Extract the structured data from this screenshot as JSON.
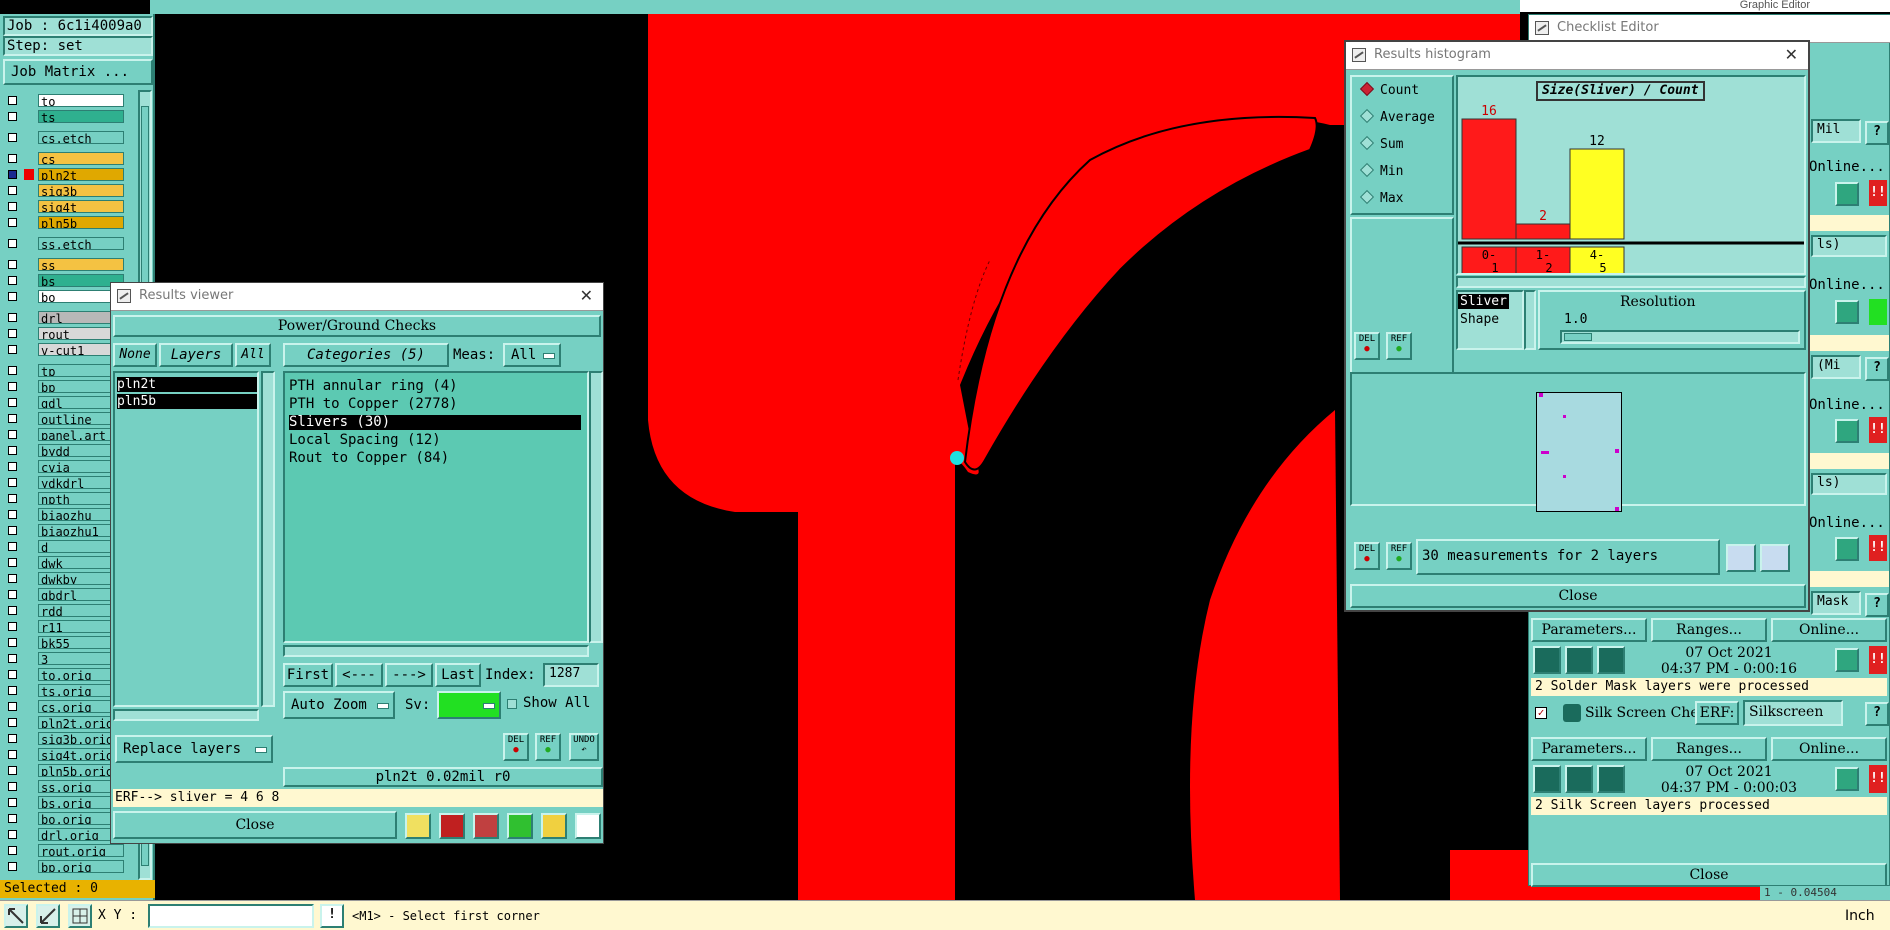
{
  "job": {
    "job_label": "Job : 6c1i4009a0",
    "step_label": "Step: set",
    "matrix_button": "Job Matrix ..."
  },
  "layers": [
    {
      "name": "to",
      "color": "#ffffff"
    },
    {
      "name": "ts",
      "color": "#2fb08f"
    },
    {
      "name": "cs.etch",
      "color": "#76d0c3"
    },
    {
      "name": "cs",
      "color": "#f4c242"
    },
    {
      "name": "pln2t",
      "color": "#e0a800"
    },
    {
      "name": "sig3b",
      "color": "#f4c242"
    },
    {
      "name": "sig4t",
      "color": "#f4c242"
    },
    {
      "name": "pln5b",
      "color": "#e0a800"
    },
    {
      "name": "ss.etch",
      "color": "#76d0c3"
    },
    {
      "name": "ss",
      "color": "#f4c242"
    },
    {
      "name": "bs",
      "color": "#2fb08f"
    },
    {
      "name": "bo",
      "color": "#ffffff"
    },
    {
      "name": "drl",
      "color": "#b8b8b8"
    },
    {
      "name": "rout",
      "color": "#d8d8d8"
    },
    {
      "name": "v-cut1",
      "color": "#d8d8d8"
    },
    {
      "name": "tp",
      "color": "#76d0c3"
    },
    {
      "name": "bp",
      "color": "#76d0c3"
    },
    {
      "name": "gdl",
      "color": "#76d0c3"
    },
    {
      "name": "outline",
      "color": "#76d0c3"
    },
    {
      "name": "panel.art",
      "color": "#76d0c3"
    },
    {
      "name": "bydd",
      "color": "#76d0c3"
    },
    {
      "name": "cvia",
      "color": "#76d0c3"
    },
    {
      "name": "ydkdrl",
      "color": "#76d0c3"
    },
    {
      "name": "npth",
      "color": "#76d0c3"
    },
    {
      "name": "biaozhu",
      "color": "#76d0c3"
    },
    {
      "name": "biaozhu1",
      "color": "#76d0c3"
    },
    {
      "name": "d",
      "color": "#76d0c3"
    },
    {
      "name": "dwk",
      "color": "#76d0c3"
    },
    {
      "name": "dwkby",
      "color": "#76d0c3"
    },
    {
      "name": "gbdrl",
      "color": "#76d0c3"
    },
    {
      "name": "rdd",
      "color": "#76d0c3"
    },
    {
      "name": "r11",
      "color": "#76d0c3"
    },
    {
      "name": "bk55",
      "color": "#76d0c3"
    },
    {
      "name": "3",
      "color": "#76d0c3"
    },
    {
      "name": "to.orig",
      "color": "#76d0c3"
    },
    {
      "name": "ts.orig",
      "color": "#76d0c3"
    },
    {
      "name": "cs.orig",
      "color": "#76d0c3"
    },
    {
      "name": "pln2t.orig",
      "color": "#76d0c3"
    },
    {
      "name": "sig3b.orig",
      "color": "#76d0c3"
    },
    {
      "name": "sig4t.orig",
      "color": "#76d0c3"
    },
    {
      "name": "pln5b.orig",
      "color": "#76d0c3"
    },
    {
      "name": "ss.orig",
      "color": "#76d0c3"
    },
    {
      "name": "bs.orig",
      "color": "#76d0c3"
    },
    {
      "name": "bo.orig",
      "color": "#76d0c3"
    },
    {
      "name": "drl.orig",
      "color": "#76d0c3"
    },
    {
      "name": "rout.orig",
      "color": "#76d0c3"
    },
    {
      "name": "bp.orig",
      "color": "#76d0c3"
    }
  ],
  "selected_label": "Selected : 0",
  "top_right_title": "Graphic Editor",
  "checklist": {
    "title": "Checklist Editor",
    "fragments": [
      "Mil",
      "ls)",
      "(Mi",
      "ls)",
      "Mask"
    ],
    "params_label": "Parameters...",
    "ranges_label": "Ranges...",
    "online_label": "Online...",
    "run1_date": "07 Oct 2021",
    "run1_time": "04:37 PM - 0:00:16",
    "run1_msg": "2 Solder Mask layers were processed",
    "silk_name": "Silk Screen Che",
    "erf_label": "ERF:",
    "erf_value": "Silkscreen",
    "run2_date": "07 Oct 2021",
    "run2_time": "04:37 PM - 0:00:03",
    "run2_msg": "2 Silk Screen layers processed",
    "close_label": "Close",
    "under_text": "1 - 0.04504"
  },
  "results_viewer": {
    "title": "Results viewer",
    "header": "Power/Ground Checks",
    "none_btn": "None",
    "layers_btn": "Layers",
    "all_btn": "All",
    "categories_btn": "Categories (5)",
    "meas_label": "Meas:",
    "meas_value": "All",
    "layers_list": [
      "pln2t",
      "pln5b"
    ],
    "categories": [
      "PTH annular ring (4)",
      "PTH to Copper (2778)",
      "Slivers (30)",
      "Local Spacing (12)",
      "Rout to Copper (84)"
    ],
    "first_btn": "First",
    "prev_btn": "<---",
    "next_btn": "--->",
    "last_btn": "Last",
    "index_label": "Index:",
    "index_value": "1287",
    "autozoom_btn": "Auto Zoom",
    "sv_label": "Sv:",
    "showall_label": "Show All",
    "replace_btn": "Replace layers",
    "del_label": "DEL",
    "ref_label": "REF",
    "undo_label": "UNDO",
    "status": "pln2t 0.02mil  r0",
    "erf_line": "ERF--> sliver = 4 6 8",
    "close_label": "Close"
  },
  "histogram": {
    "title": "Results histogram",
    "modes": [
      "Count",
      "Average",
      "Sum",
      "Min",
      "Max"
    ],
    "selected_mode": "Count",
    "chart_title": "Size(Sliver) / Count",
    "attr_items": [
      "Sliver",
      "Shape"
    ],
    "resolution_label": "Resolution",
    "resolution_value": "1.0",
    "del_label": "DEL",
    "ref_label": "REF",
    "summary": "30 measurements for 2 layers",
    "close_label": "Close",
    "colors": {
      "red": "#ff1a1a",
      "yellow": "#ffff22"
    }
  },
  "chart_data": {
    "type": "bar",
    "title": "Size(Sliver) / Count",
    "categories": [
      "0-1",
      "1-2",
      "4-5"
    ],
    "values": [
      16,
      2,
      12
    ],
    "colors": [
      "#ff1a1a",
      "#ff1a1a",
      "#ffff22"
    ]
  },
  "bottom": {
    "xy_label": "X Y :",
    "xy_value": "",
    "prompt": "<M1> - Select first corner",
    "units": "Inch"
  }
}
